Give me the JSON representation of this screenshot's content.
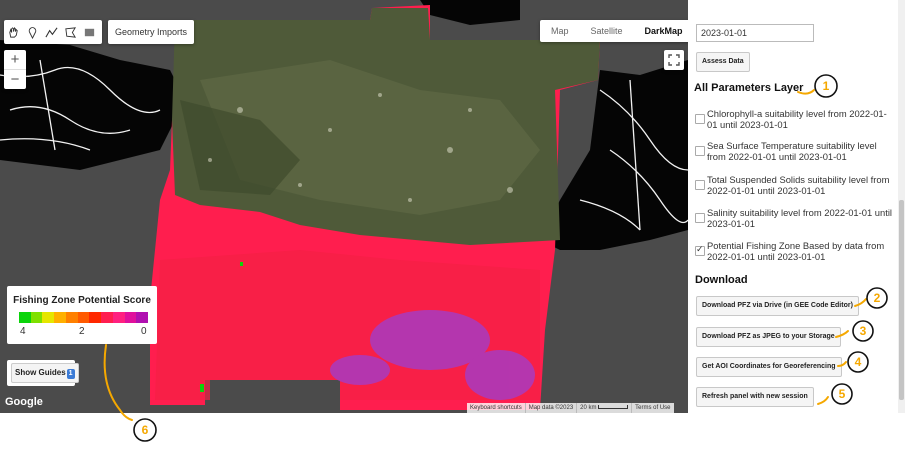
{
  "map": {
    "geometry_imports_label": "Geometry Imports",
    "zoom_in": "+",
    "zoom_out": "−",
    "map_types": [
      "Map",
      "Satellite",
      "DarkMap"
    ],
    "selected_map_type": "DarkMap",
    "google_logo": "Google",
    "attribution": [
      "Keyboard shortcuts",
      "Map data ©2023",
      "20 km",
      "Terms of Use"
    ]
  },
  "legend": {
    "title": "Fishing Zone Potential Score",
    "labels": [
      "4",
      "2",
      "0"
    ],
    "colors": [
      "#0bd40b",
      "#7fe000",
      "#e6e600",
      "#ffb000",
      "#ff8000",
      "#ff5a00",
      "#ff2800",
      "#ff1e50",
      "#ff2080",
      "#e0109c",
      "#b010b0"
    ]
  },
  "guides_button": {
    "label": "Show Guides",
    "badge": "1"
  },
  "panel": {
    "date_value": "2023-01-01",
    "assess_button": "Assess Data",
    "layers_title": "All Parameters Layer",
    "layers": [
      {
        "label": "Chlorophyll-a suitability level from 2022-01-01 until 2023-01-01",
        "checked": false
      },
      {
        "label": "Sea Surface Temperature suitability level from 2022-01-01 until 2023-01-01",
        "checked": false
      },
      {
        "label": "Total Suspended Solids suitability level from 2022-01-01 until 2023-01-01",
        "checked": false
      },
      {
        "label": "Salinity suitability level from 2022-01-01 until 2023-01-01",
        "checked": false
      },
      {
        "label": "Potential Fishing Zone Based by data from 2022-01-01 until 2023-01-01",
        "checked": true
      }
    ],
    "download_title": "Download",
    "buttons": [
      "Download PFZ via Drive (in GEE Code Editor)",
      "Download PFZ as JPEG to your Storage",
      "Get AOI Coordinates for Georeferencing",
      "Refresh panel with new session"
    ]
  },
  "annotations": [
    "1",
    "2",
    "3",
    "4",
    "5",
    "6"
  ],
  "colors": {
    "annotation": "#f5a800",
    "pfz_red": "#ff1e4e",
    "land": "#000000"
  }
}
